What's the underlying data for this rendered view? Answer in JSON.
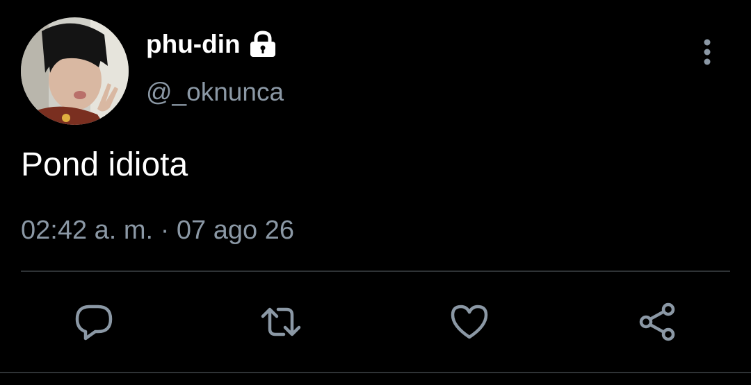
{
  "user": {
    "display_name": "phu-din",
    "handle": "@_oknunca",
    "avatar_icon": "avatar-photo",
    "protected_icon": "lock-icon"
  },
  "tweet": {
    "text": "Pond idiota",
    "time": "02:42 a. m.",
    "separator": "·",
    "date": "07 ago 26"
  },
  "actions": [
    {
      "name": "reply",
      "icon": "comment-icon"
    },
    {
      "name": "retweet",
      "icon": "retweet-icon"
    },
    {
      "name": "like",
      "icon": "heart-icon"
    },
    {
      "name": "share",
      "icon": "share-icon"
    }
  ],
  "colors": {
    "background": "#000000",
    "primary_text": "#ffffff",
    "secondary_text": "#8b98a5",
    "divider": "#2f3336"
  }
}
